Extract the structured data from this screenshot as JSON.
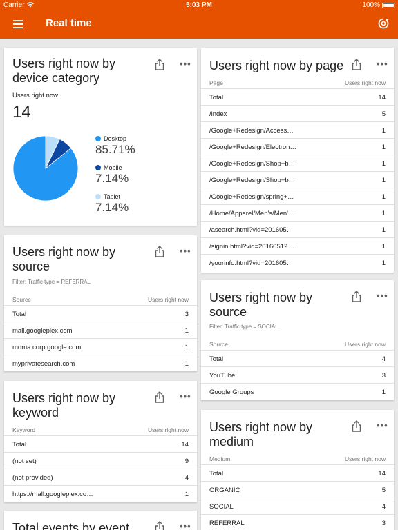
{
  "status_bar": {
    "carrier": "Carrier",
    "time": "5:03 PM",
    "battery": "100%"
  },
  "app_bar": {
    "title": "Real time"
  },
  "device_card": {
    "title_line1": "Users right now by",
    "title_line2": "device category",
    "users_label": "Users right now",
    "users_value": "14",
    "legend": [
      {
        "name": "Desktop",
        "value": "85.71%",
        "color": "#2196f3"
      },
      {
        "name": "Mobile",
        "value": "7.14%",
        "color": "#0d47a1"
      },
      {
        "name": "Tablet",
        "value": "7.14%",
        "color": "#bbdefb"
      }
    ]
  },
  "page_card": {
    "title": "Users right now by page",
    "col_left": "Page",
    "col_right": "Users right now",
    "rows": [
      {
        "label": "Total",
        "value": "14"
      },
      {
        "label": "/index",
        "value": "5"
      },
      {
        "label": "/Google+Redesign/Access…",
        "value": "1"
      },
      {
        "label": "/Google+Redesign/Electron…",
        "value": "1"
      },
      {
        "label": "/Google+Redesign/Shop+b…",
        "value": "1"
      },
      {
        "label": "/Google+Redesign/Shop+b…",
        "value": "1"
      },
      {
        "label": "/Google+Redesign/spring+…",
        "value": "1"
      },
      {
        "label": "/Home/Apparel/Men's/Men'…",
        "value": "1"
      },
      {
        "label": "/asearch.html?vid=201605…",
        "value": "1"
      },
      {
        "label": "/signin.html?vid=20160512…",
        "value": "1"
      },
      {
        "label": "/yourinfo.html?vid=201605…",
        "value": "1"
      }
    ]
  },
  "source_referral_card": {
    "title_line1": "Users right now by",
    "title_line2": "source",
    "filter": "Filter: Traffic type = REFERRAL",
    "col_left": "Source",
    "col_right": "Users right now",
    "rows": [
      {
        "label": "Total",
        "value": "3"
      },
      {
        "label": "mall.googleplex.com",
        "value": "1"
      },
      {
        "label": "moma.corp.google.com",
        "value": "1"
      },
      {
        "label": "myprivatesearch.com",
        "value": "1"
      }
    ]
  },
  "source_social_card": {
    "title_line1": "Users right now by",
    "title_line2": "source",
    "filter": "Filter: Traffic type = SOCIAL",
    "col_left": "Source",
    "col_right": "Users right now",
    "rows": [
      {
        "label": "Total",
        "value": "4"
      },
      {
        "label": "YouTube",
        "value": "3"
      },
      {
        "label": "Google Groups",
        "value": "1"
      }
    ]
  },
  "keyword_card": {
    "title_line1": "Users right now by",
    "title_line2": "keyword",
    "col_left": "Keyword",
    "col_right": "Users right now",
    "rows": [
      {
        "label": "Total",
        "value": "14"
      },
      {
        "label": "(not set)",
        "value": "9"
      },
      {
        "label": "(not provided)",
        "value": "4"
      },
      {
        "label": "https://mall.googleplex.co…",
        "value": "1"
      }
    ]
  },
  "medium_card": {
    "title_line1": "Users right now by",
    "title_line2": "medium",
    "col_left": "Medium",
    "col_right": "Users right now",
    "rows": [
      {
        "label": "Total",
        "value": "14"
      },
      {
        "label": "ORGANIC",
        "value": "5"
      },
      {
        "label": "SOCIAL",
        "value": "4"
      },
      {
        "label": "REFERRAL",
        "value": "3"
      }
    ]
  },
  "events_card": {
    "title": "Total events by event"
  }
}
